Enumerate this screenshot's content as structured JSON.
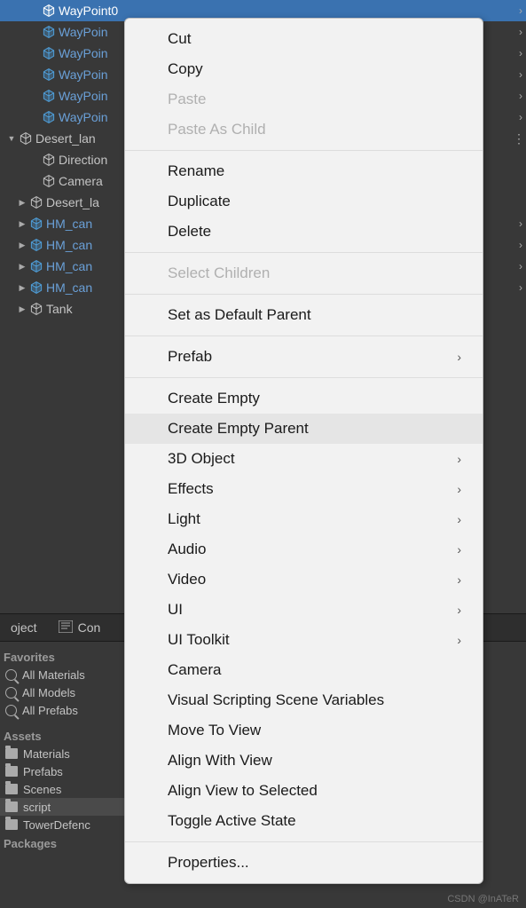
{
  "hierarchy": {
    "items": [
      {
        "indent": 32,
        "expand": "",
        "icon": "prefab",
        "label": "WayPoint0",
        "selected": true,
        "chev": true,
        "prefab": true
      },
      {
        "indent": 32,
        "expand": "",
        "icon": "prefab",
        "label": "WayPoin",
        "chev": true,
        "prefab": true
      },
      {
        "indent": 32,
        "expand": "",
        "icon": "prefab",
        "label": "WayPoin",
        "chev": true,
        "prefab": true
      },
      {
        "indent": 32,
        "expand": "",
        "icon": "prefab",
        "label": "WayPoin",
        "chev": true,
        "prefab": true
      },
      {
        "indent": 32,
        "expand": "",
        "icon": "prefab",
        "label": "WayPoin",
        "chev": true,
        "prefab": true
      },
      {
        "indent": 32,
        "expand": "",
        "icon": "prefab",
        "label": "WayPoin",
        "chev": true,
        "prefab": true
      },
      {
        "indent": 6,
        "expand": "▼",
        "icon": "go",
        "label": "Desert_lan",
        "vbar": true
      },
      {
        "indent": 32,
        "expand": "",
        "icon": "go",
        "label": "Direction"
      },
      {
        "indent": 32,
        "expand": "",
        "icon": "go",
        "label": "Camera "
      },
      {
        "indent": 18,
        "expand": "▶",
        "icon": "go",
        "label": "Desert_la"
      },
      {
        "indent": 18,
        "expand": "▶",
        "icon": "prefab",
        "label": "HM_can",
        "chev": true,
        "prefab": true
      },
      {
        "indent": 18,
        "expand": "▶",
        "icon": "prefab",
        "label": "HM_can",
        "chev": true,
        "prefab": true
      },
      {
        "indent": 18,
        "expand": "▶",
        "icon": "prefab",
        "label": "HM_can",
        "chev": true,
        "prefab": true
      },
      {
        "indent": 18,
        "expand": "▶",
        "icon": "prefab",
        "label": "HM_can",
        "chev": true,
        "prefab": true
      },
      {
        "indent": 18,
        "expand": "▶",
        "icon": "go",
        "label": "Tank"
      }
    ]
  },
  "context_menu": [
    {
      "label": "Cut"
    },
    {
      "label": "Copy"
    },
    {
      "label": "Paste",
      "disabled": true
    },
    {
      "label": "Paste As Child",
      "disabled": true
    },
    {
      "sep": true
    },
    {
      "label": "Rename"
    },
    {
      "label": "Duplicate"
    },
    {
      "label": "Delete"
    },
    {
      "sep": true
    },
    {
      "label": "Select Children",
      "disabled": true
    },
    {
      "sep": true
    },
    {
      "label": "Set as Default Parent"
    },
    {
      "sep": true
    },
    {
      "label": "Prefab",
      "submenu": true
    },
    {
      "sep": true
    },
    {
      "label": "Create Empty"
    },
    {
      "label": "Create Empty Parent",
      "hover": true
    },
    {
      "label": "3D Object",
      "submenu": true
    },
    {
      "label": "Effects",
      "submenu": true
    },
    {
      "label": "Light",
      "submenu": true
    },
    {
      "label": "Audio",
      "submenu": true
    },
    {
      "label": "Video",
      "submenu": true
    },
    {
      "label": "UI",
      "submenu": true
    },
    {
      "label": "UI Toolkit",
      "submenu": true
    },
    {
      "label": "Camera"
    },
    {
      "label": "Visual Scripting Scene Variables"
    },
    {
      "label": "Move To View"
    },
    {
      "label": "Align With View"
    },
    {
      "label": "Align View to Selected"
    },
    {
      "label": "Toggle Active State"
    },
    {
      "sep": true
    },
    {
      "label": "Properties..."
    }
  ],
  "tabs": {
    "project": "oject",
    "console": "Con"
  },
  "favorites": {
    "header": "Favorites",
    "items": [
      "All Materials",
      "All Models",
      "All Prefabs"
    ]
  },
  "assets": {
    "header": "Assets",
    "items": [
      {
        "label": "Materials"
      },
      {
        "label": "Prefabs"
      },
      {
        "label": "Scenes"
      },
      {
        "label": "script",
        "selected": true
      },
      {
        "label": "TowerDefenc"
      }
    ],
    "packages": "Packages"
  },
  "watermark": "CSDN @InATeR"
}
